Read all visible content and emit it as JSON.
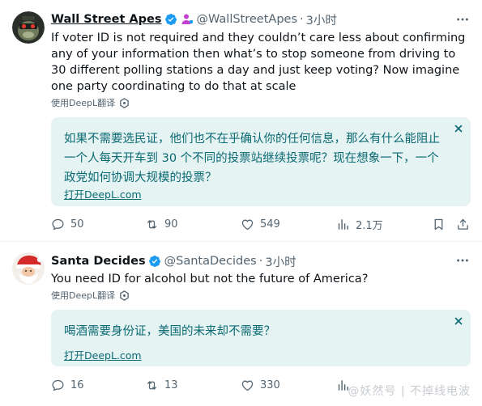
{
  "colors": {
    "verified_blue": "#1d9bf0",
    "affiliate_purple": "#c53fd1",
    "translate_bg": "#e6f3f3",
    "translate_text": "#0a6a73",
    "secondary_text": "#536471"
  },
  "tweets": [
    {
      "author_name": "Wall Street Apes",
      "handle": "@WallStreetApes",
      "separator": "·",
      "time": "3小时",
      "text": "If voter ID is not required and they couldn’t care less about confirming any of your information then what’s to stop someone from driving to 30 different polling stations a day and just keep voting? Now imagine one party coordinating to do that at scale",
      "translate_label": "使用DeepL翻译",
      "translation_text": "如果不需要选民证，他们也不在乎确认你的任何信息，那么有什么能阻止一个人每天开车到 30 个不同的投票站继续投票呢？现在想象一下，一个政党如何协调大规模的投票？",
      "open_deepl_label": "打开DeepL.com",
      "stats": {
        "replies": "50",
        "retweets": "90",
        "likes": "549",
        "views": "2.1万"
      },
      "icons": {
        "avatar": "ape-avatar",
        "verified": "verified-badge-icon",
        "affiliate": "affiliate-user-icon",
        "more": "more-dots-icon"
      }
    },
    {
      "author_name": "Santa Decides",
      "handle": "@SantaDecides",
      "separator": "·",
      "time": "3小时",
      "text": "You need ID for alcohol but not the future of America?",
      "translate_label": "使用DeepL翻译",
      "translation_text": "喝酒需要身份证，美国的未来却不需要？",
      "open_deepl_label": "打开DeepL.com",
      "stats": {
        "replies": "16",
        "retweets": "13",
        "likes": "330"
      },
      "icons": {
        "avatar": "santa-avatar",
        "verified": "verified-badge-icon",
        "more": "more-dots-icon"
      }
    }
  ],
  "watermark": "@妖然号 | 不掉线电波"
}
